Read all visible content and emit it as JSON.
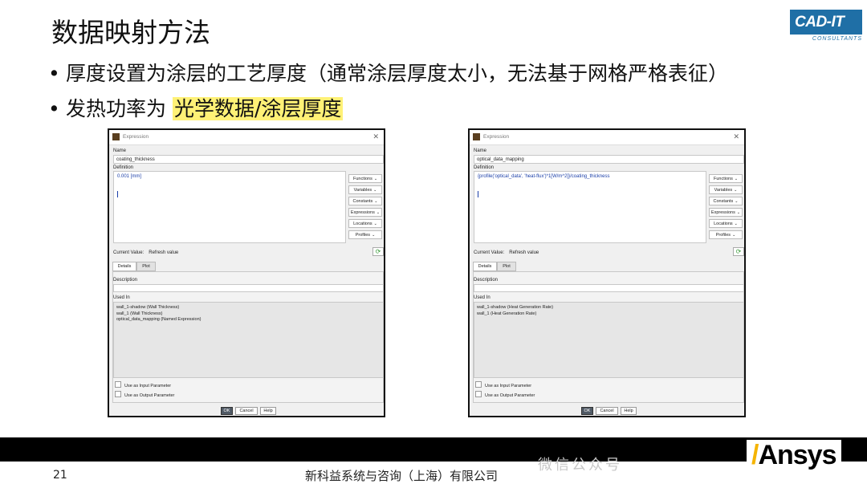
{
  "slide": {
    "title": "数据映射方法",
    "bullets": [
      {
        "text": "厚度设置为涂层的工艺厚度（通常涂层厚度太小，无法基于网格严格表征）",
        "highlight": ""
      },
      {
        "text": "发热功率为 ",
        "highlight": "光学数据/涂层厚度"
      }
    ],
    "page_number": "21",
    "company": "新科益系统与咨询（上海）有限公司",
    "watermark": "微信公众号",
    "logo": {
      "main": "CAD-IT",
      "sub": "CONSULTANTS"
    },
    "brand": "Ansys",
    "colors": {
      "highlight": "#fff176",
      "logo_blue": "#1f6fa6",
      "ansys_accent": "#f5b400"
    }
  },
  "dialogs": [
    {
      "window_title": "Expression",
      "name_label": "Name",
      "name_value": "coating_thickness",
      "definition_label": "Definition",
      "definition_value": "0.001 [mm]",
      "side_buttons": [
        "Functions",
        "Variables",
        "Constants",
        "Expressions",
        "Locations",
        "Profiles"
      ],
      "current_value_label": "Current Value:",
      "current_value": "Refresh value",
      "tabs": [
        "Details",
        "Plot"
      ],
      "description_label": "Description",
      "description_value": "",
      "used_in_label": "Used In",
      "used_in": [
        "wall_1-shadow (Wall Thickness)",
        "wall_1 (Wall Thickness)",
        "optical_data_mapping (Named Expression)"
      ],
      "checkbox_input": "Use as Input Parameter",
      "checkbox_output": "Use as Output Parameter",
      "ok": "OK",
      "cancel": "Cancel",
      "help": "Help"
    },
    {
      "window_title": "Expression",
      "name_label": "Name",
      "name_value": "optical_data_mapping",
      "definition_label": "Definition",
      "definition_value": "{profile('optical_data', 'heat-flux')*1[W/m^2]}/coating_thickness",
      "side_buttons": [
        "Functions",
        "Variables",
        "Constants",
        "Expressions",
        "Locations",
        "Profiles"
      ],
      "current_value_label": "Current Value:",
      "current_value": "Refresh value",
      "tabs": [
        "Details",
        "Plot"
      ],
      "description_label": "Description",
      "description_value": "",
      "used_in_label": "Used In",
      "used_in": [
        "wall_1-shadow (Heat Generation Rate)",
        "wall_1 (Heat Generation Rate)"
      ],
      "checkbox_input": "Use as Input Parameter",
      "checkbox_output": "Use as Output Parameter",
      "ok": "OK",
      "cancel": "Cancel",
      "help": "Help"
    }
  ]
}
